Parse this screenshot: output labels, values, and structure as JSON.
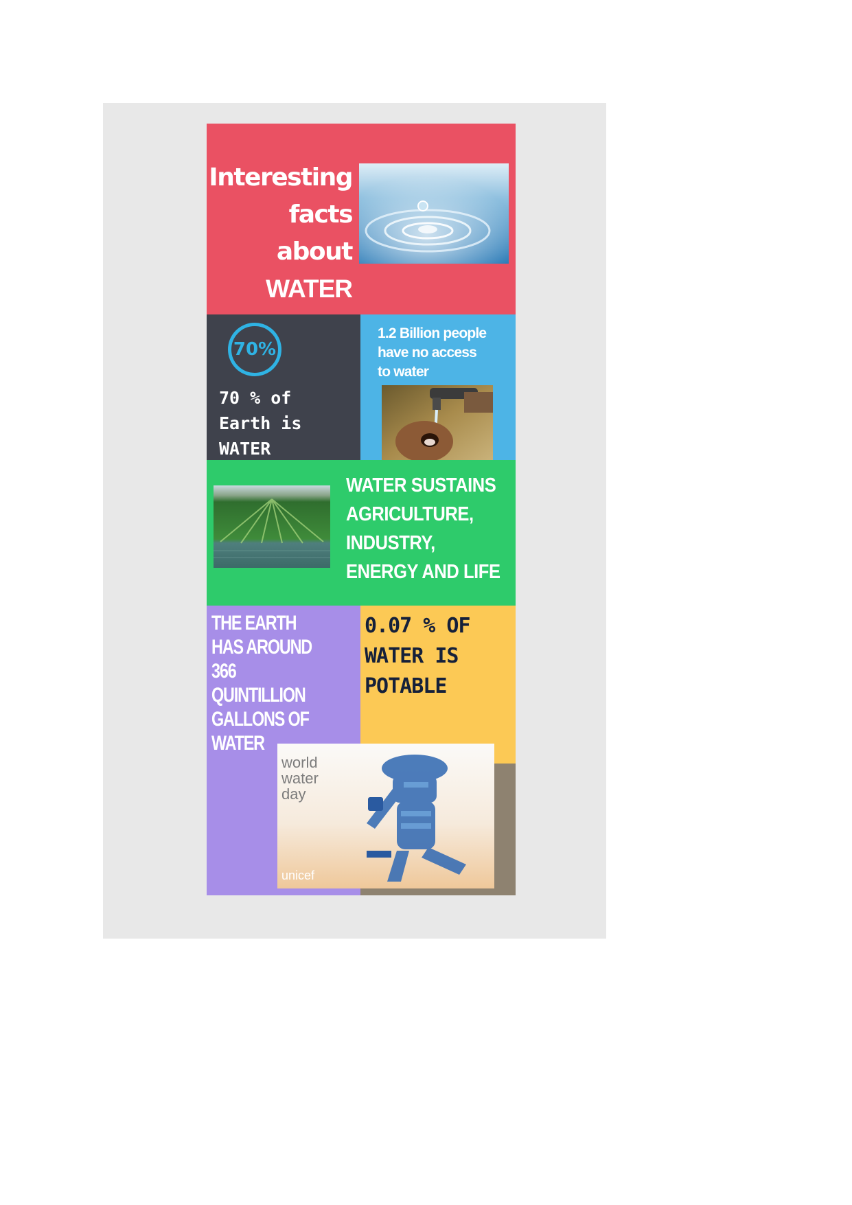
{
  "title": {
    "line1": "Interesting",
    "line2": "facts about",
    "line3": "WATER"
  },
  "fact_percent": {
    "badge": "70%",
    "line1": "70 % of",
    "line2": "Earth is",
    "line3": "WATER"
  },
  "fact_access": {
    "line1": "1.2 Billion people",
    "line2": "have no access",
    "line3": "to water"
  },
  "fact_sustains": {
    "line1": "WATER SUSTAINS",
    "line2": "AGRICULTURE,",
    "line3": "INDUSTRY,",
    "line4": "ENERGY AND LIFE"
  },
  "fact_gallons": {
    "line1": "THE EARTH",
    "line2": "HAS AROUND",
    "line3": "366",
    "line4": "QUINTILLION",
    "line5": "GALLONS OF",
    "line6": "WATER"
  },
  "fact_potable": {
    "line1": "0.07 % OF",
    "line2": "WATER IS",
    "line3": "POTABLE"
  },
  "world_water_day": {
    "line1": "world",
    "line2": "water",
    "line3": "day",
    "logo": "unicef"
  },
  "colors": {
    "title_bg": "#ea5163",
    "dark_bg": "#3f424c",
    "blue_bg": "#4db4e6",
    "green_bg": "#2ecb6b",
    "purple_bg": "#a78ee8",
    "yellow_bg": "#fcc955",
    "accent_ring": "#2fb3e4"
  }
}
